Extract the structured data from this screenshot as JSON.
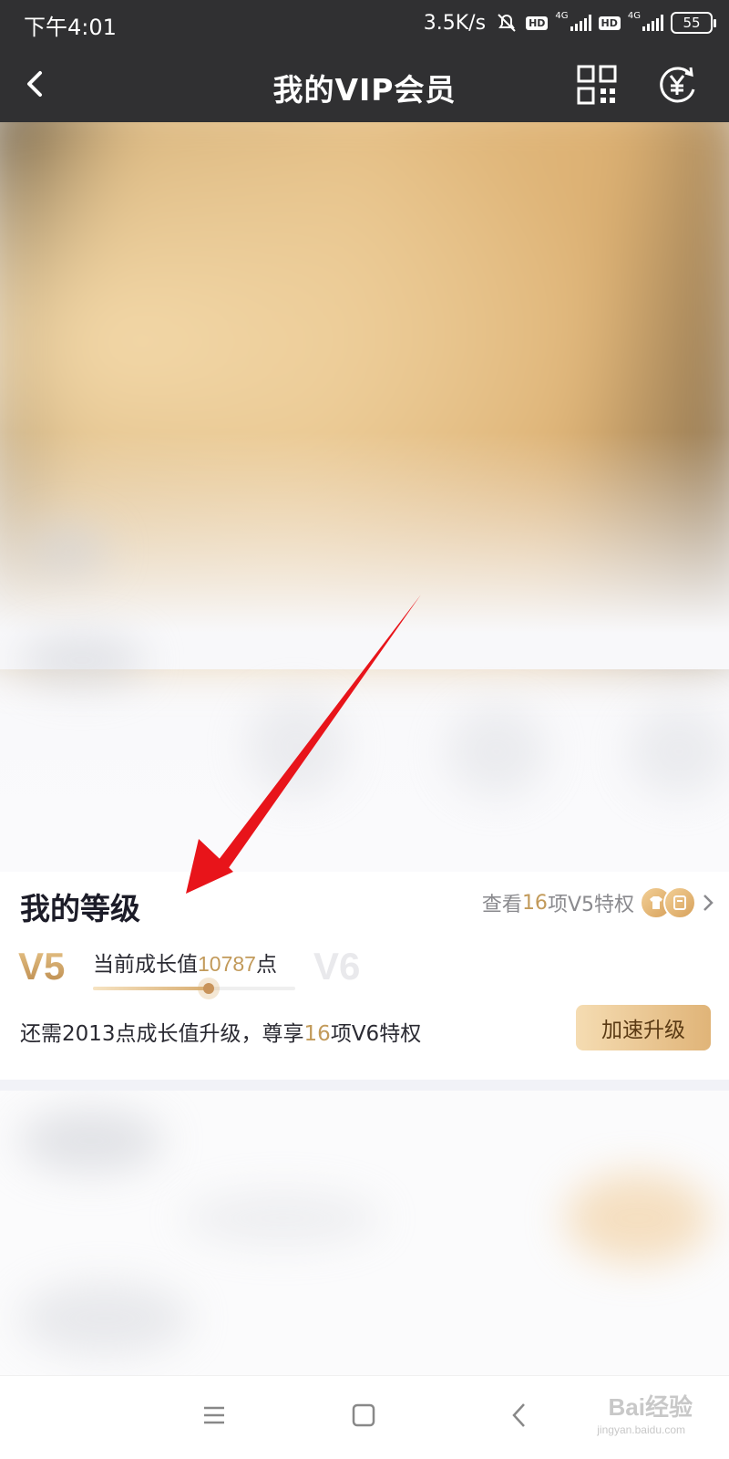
{
  "status_bar": {
    "time": "下午4:01",
    "speed": "3.5K/s",
    "hd": "HD",
    "network": "4G",
    "battery": "55"
  },
  "nav": {
    "title": "我的VIP会员",
    "back_icon": "chevron-left-icon",
    "qr_icon": "qr-code-icon",
    "coin_icon": "yuan-refresh-icon"
  },
  "level": {
    "title": "我的等级",
    "privilege_prefix": "查看",
    "privilege_count": "16",
    "privilege_suffix": "项V5特权",
    "current_level": "V5",
    "next_level": "V6",
    "growth_prefix": "当前成长值",
    "growth_value": "10787",
    "growth_suffix": "点",
    "progress": 0.57,
    "upgrade_prefix": "还需2013点成长值升级，尊享",
    "upgrade_count": "16",
    "upgrade_suffix": "项V6特权",
    "upgrade_button": "加速升级",
    "badge_icons": [
      "shirt-icon",
      "card-icon"
    ],
    "arrow_icon": "chevron-right-icon"
  },
  "bottom_nav": {
    "menu_icon": "menu-icon",
    "home_icon": "square-home-icon",
    "back_icon": "back-triangle-icon"
  },
  "watermark": {
    "text": "Bai经验",
    "sub": "jingyan.baidu.com"
  },
  "colors": {
    "header_bg": "#303032",
    "gold": "#c29a5a",
    "annotation": "#e8141a"
  }
}
